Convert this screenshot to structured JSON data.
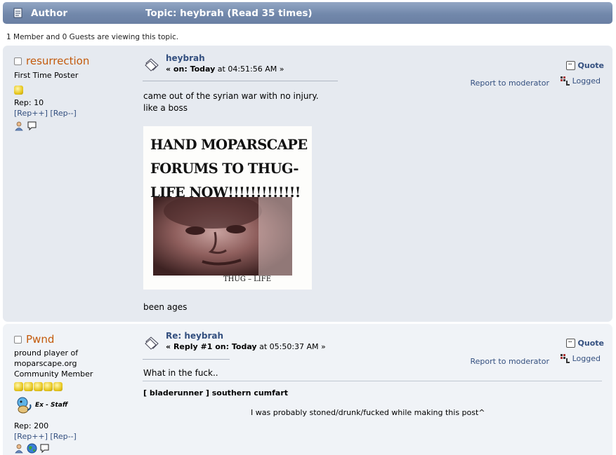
{
  "header": {
    "author_label": "Author",
    "topic_label": "Topic: heybrah  (Read 35 times)"
  },
  "viewers": "1 Member and 0 Guests are viewing this topic.",
  "posts": [
    {
      "username": "resurrection",
      "title_lines": [
        "First Time Poster"
      ],
      "stars": 1,
      "rep": "Rep: 10",
      "rep_plus": "[Rep++]",
      "rep_minus": "[Rep--]",
      "subject": "heybrah",
      "date_prefix": "« on: ",
      "date_day": "Today",
      "date_time": " at 04:51:56 AM »",
      "quote_label": "Quote",
      "report_label": "Report to moderator",
      "logged_label": "Logged",
      "body_lines": [
        "came out of the syrian war with no injury.",
        "like a boss"
      ],
      "image_text": [
        "HAND MOPARSCAPE",
        "FORUMS TO THUG-",
        "LIFE NOW!!!!!!!!!!!!!"
      ],
      "image_caption": "THUG – LIFE",
      "after_image": "been ages"
    },
    {
      "username": "Pwnd",
      "title_lines": [
        "pround player of",
        "moparscape.org",
        "Community Member"
      ],
      "stars": 5,
      "staff_label": "Ex - Staff",
      "rep": "Rep: 200",
      "rep_plus": "[Rep++]",
      "rep_minus": "[Rep--]",
      "subject": "Re: heybrah",
      "date_prefix": "« ",
      "date_reply": "Reply #1 on: ",
      "date_day": "Today",
      "date_time": " at 05:50:37 AM »",
      "quote_label": "Quote",
      "report_label": "Report to moderator",
      "logged_label": "Logged",
      "body_lines": [
        "What in the fuck.."
      ],
      "signature_line1": "[ bladerunner ] southern cumfart",
      "signature_line2": "I was probably stoned/drunk/fucked while making this post^"
    }
  ]
}
